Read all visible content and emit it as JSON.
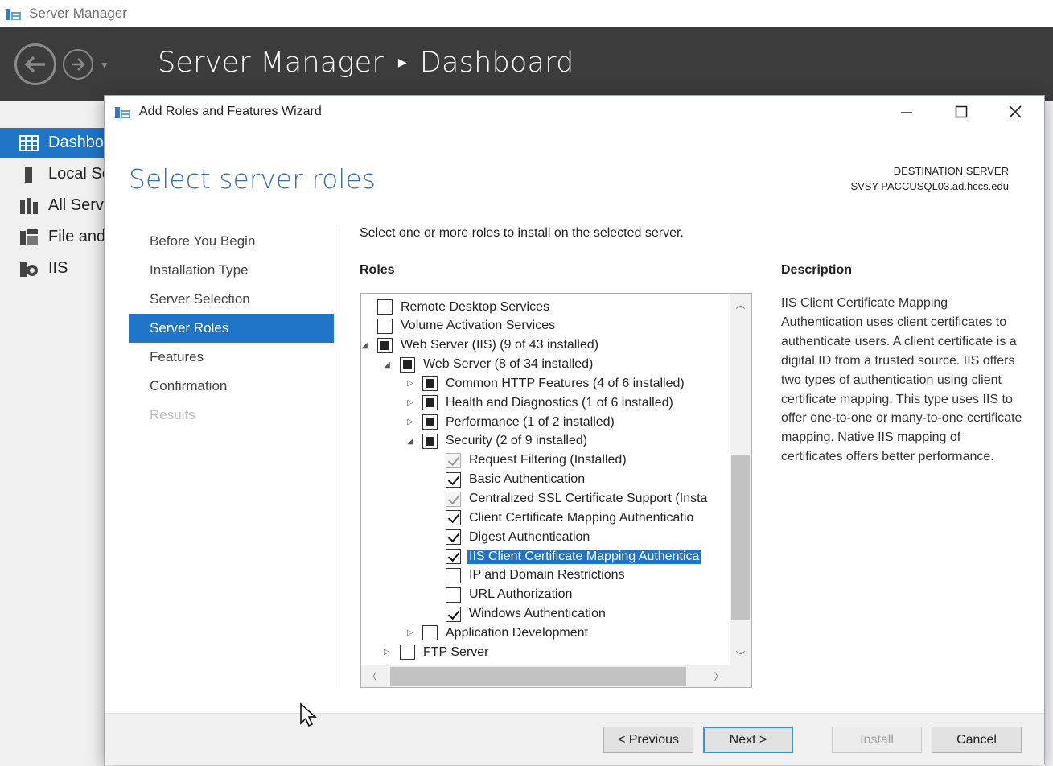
{
  "outer_window": {
    "title": "Server Manager",
    "breadcrumb": {
      "app": "Server Manager",
      "page": "Dashboard"
    },
    "sidebar": [
      {
        "label": "Dashboard",
        "icon": "dashboard-icon",
        "active": true
      },
      {
        "label": "Local Server",
        "icon": "server-icon"
      },
      {
        "label": "All Servers",
        "icon": "servers-icon"
      },
      {
        "label": "File and Storage Services",
        "icon": "file-services-icon"
      },
      {
        "label": "IIS",
        "icon": "iis-icon"
      }
    ]
  },
  "wizard": {
    "title": "Add Roles and Features Wizard",
    "heading": "Select server roles",
    "destination": {
      "label": "DESTINATION SERVER",
      "server": "SVSY-PACCUSQL03.ad.hccs.edu"
    },
    "steps": [
      {
        "label": "Before You Begin",
        "state": "normal"
      },
      {
        "label": "Installation Type",
        "state": "normal"
      },
      {
        "label": "Server Selection",
        "state": "normal"
      },
      {
        "label": "Server Roles",
        "state": "active"
      },
      {
        "label": "Features",
        "state": "normal"
      },
      {
        "label": "Confirmation",
        "state": "normal"
      },
      {
        "label": "Results",
        "state": "disabled"
      }
    ],
    "instruction": "Select one or more roles to install on the selected server.",
    "roles_label": "Roles",
    "roles_tree": [
      {
        "label": "Remote Desktop Services",
        "level": 0,
        "expander": "",
        "check": "unchecked"
      },
      {
        "label": "Volume Activation Services",
        "level": 0,
        "expander": "",
        "check": "unchecked"
      },
      {
        "label": "Web Server (IIS) (9 of 43 installed)",
        "level": 0,
        "expander": "expanded",
        "check": "partial"
      },
      {
        "label": "Web Server (8 of 34 installed)",
        "level": 1,
        "expander": "expanded",
        "check": "partial"
      },
      {
        "label": "Common HTTP Features (4 of 6 installed)",
        "level": 2,
        "expander": "collapsed",
        "check": "partial"
      },
      {
        "label": "Health and Diagnostics (1 of 6 installed)",
        "level": 2,
        "expander": "collapsed",
        "check": "partial"
      },
      {
        "label": "Performance (1 of 2 installed)",
        "level": 2,
        "expander": "collapsed",
        "check": "partial"
      },
      {
        "label": "Security (2 of 9 installed)",
        "level": 2,
        "expander": "expanded",
        "check": "partial"
      },
      {
        "label": "Request Filtering (Installed)",
        "level": 3,
        "expander": "",
        "check": "installed"
      },
      {
        "label": "Basic Authentication",
        "level": 3,
        "expander": "",
        "check": "checked"
      },
      {
        "label": "Centralized SSL Certificate Support (Insta",
        "level": 3,
        "expander": "",
        "check": "installed"
      },
      {
        "label": "Client Certificate Mapping Authenticatio",
        "level": 3,
        "expander": "",
        "check": "checked"
      },
      {
        "label": "Digest Authentication",
        "level": 3,
        "expander": "",
        "check": "checked"
      },
      {
        "label": "IIS Client Certificate Mapping Authentica",
        "level": 3,
        "expander": "",
        "check": "checked",
        "selected": true
      },
      {
        "label": "IP and Domain Restrictions",
        "level": 3,
        "expander": "",
        "check": "unchecked"
      },
      {
        "label": "URL Authorization",
        "level": 3,
        "expander": "",
        "check": "unchecked"
      },
      {
        "label": "Windows Authentication",
        "level": 3,
        "expander": "",
        "check": "checked"
      },
      {
        "label": "Application Development",
        "level": 2,
        "expander": "collapsed",
        "check": "unchecked"
      },
      {
        "label": "FTP Server",
        "level": 1,
        "expander": "collapsed",
        "check": "unchecked"
      }
    ],
    "description_label": "Description",
    "description_text": "IIS Client Certificate Mapping Authentication uses client certificates to authenticate users. A client certificate is a digital ID from a trusted source. IIS offers two types of authentication using client certificate mapping. This type uses IIS to offer one-to-one or many-to-one certificate mapping. Native IIS mapping of certificates offers better performance.",
    "buttons": {
      "previous": "< Previous",
      "next": "Next >",
      "install": "Install",
      "cancel": "Cancel"
    }
  },
  "colors": {
    "accent": "#1f75c7",
    "header_bg": "#3c3c3c",
    "heading_blue": "#3d6fa6"
  }
}
